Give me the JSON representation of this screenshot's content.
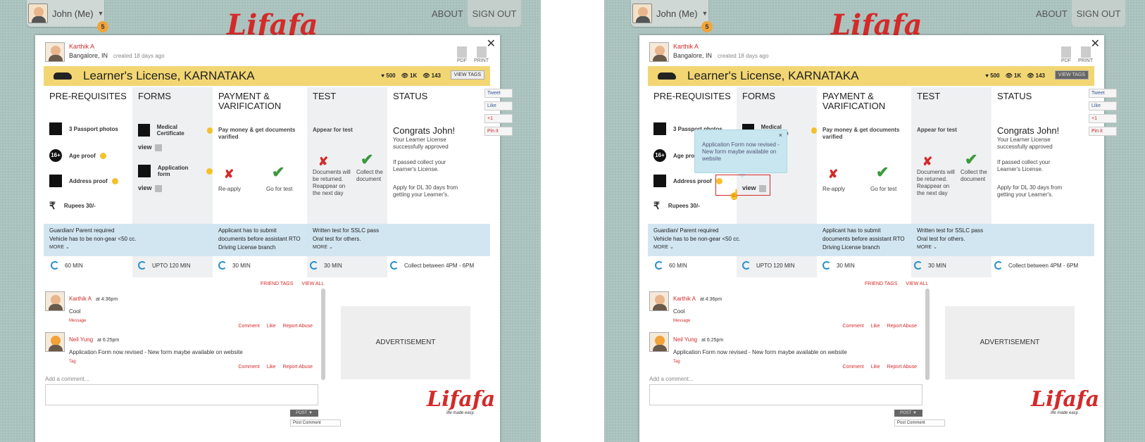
{
  "topbar": {
    "user": "John (Me)",
    "notif": "5",
    "logo": "Lifafa",
    "about": "ABOUT",
    "signout": "SIGN OUT"
  },
  "card": {
    "author": "Karthik A",
    "location": "Bangalore, IN",
    "created": "created 18 days ago",
    "pdf": "PDF",
    "print": "PRINT",
    "title": "Learner's License, KARNATAKA",
    "stat1": "500",
    "stat2": "1K",
    "stat3": "143",
    "viewtags": "VIEW TAGS"
  },
  "columns": {
    "prereq": "PRE-REQUISITES",
    "forms": "FORMS",
    "payment": "PAYMENT & VARIFICATION",
    "test": "TEST",
    "status": "STATUS"
  },
  "prereq_items": [
    "3 Passport photos",
    "Age proof",
    "Address proof",
    "Rupees 30/-"
  ],
  "age_badge": "16+",
  "forms": {
    "f1": "Medical Certificate",
    "f2": "Application form",
    "view": "view"
  },
  "payment": {
    "head": "Pay money & get documents varified",
    "reapply": "Re-apply",
    "gotest": "Go for test"
  },
  "test": {
    "head": "Appear for test",
    "fail": "Documents will be returned. Reappear on the next day",
    "pass": "Collect the document"
  },
  "status": {
    "congrats": "Congrats John!",
    "line1": "Your Learner License successfully approved",
    "line2": "If passed collect your Learner's License.",
    "line3": "Apply for DL 30 days from getting your Learner's."
  },
  "info": {
    "a1": "Guardian/ Parent required",
    "a2": "Vehicle has to be non-gear <50 cc.",
    "b": "Applicant has to submit documents before assistant RTO Driving License branch",
    "c1": "Written test for SSLC pass",
    "c2": "Oral test for others.",
    "more": "MORE"
  },
  "times": [
    "60 MIN",
    "UPTO 120 MIN",
    "30 MIN",
    "30 MIN",
    "Collect between 4PM - 6PM"
  ],
  "links": {
    "friend": "FRIEND TAGS",
    "viewall": "VIEW ALL"
  },
  "comments": [
    {
      "name": "Karthik A",
      "time": "at 4:36pm",
      "text": "Cool",
      "tag": "Message"
    },
    {
      "name": "Neil Yung",
      "time": "at 6:25pm",
      "text": "Application Form now revised - New form maybe available on website",
      "tag": "Tag"
    }
  ],
  "actions": {
    "comment": "Comment",
    "like": "Like",
    "report": "Report Abuse"
  },
  "ad": "ADVERTISEMENT",
  "add_comment": "Add a comment...",
  "post": "POST",
  "post_comment": "Post Comment",
  "logo_tagline": "life made easy.",
  "social": {
    "tweet": "Tweet",
    "like": "Like",
    "plus": "+1",
    "pin": "Pin it"
  },
  "popup": {
    "text": "Application Form now revised - New form maybe available on website",
    "close": "×"
  }
}
